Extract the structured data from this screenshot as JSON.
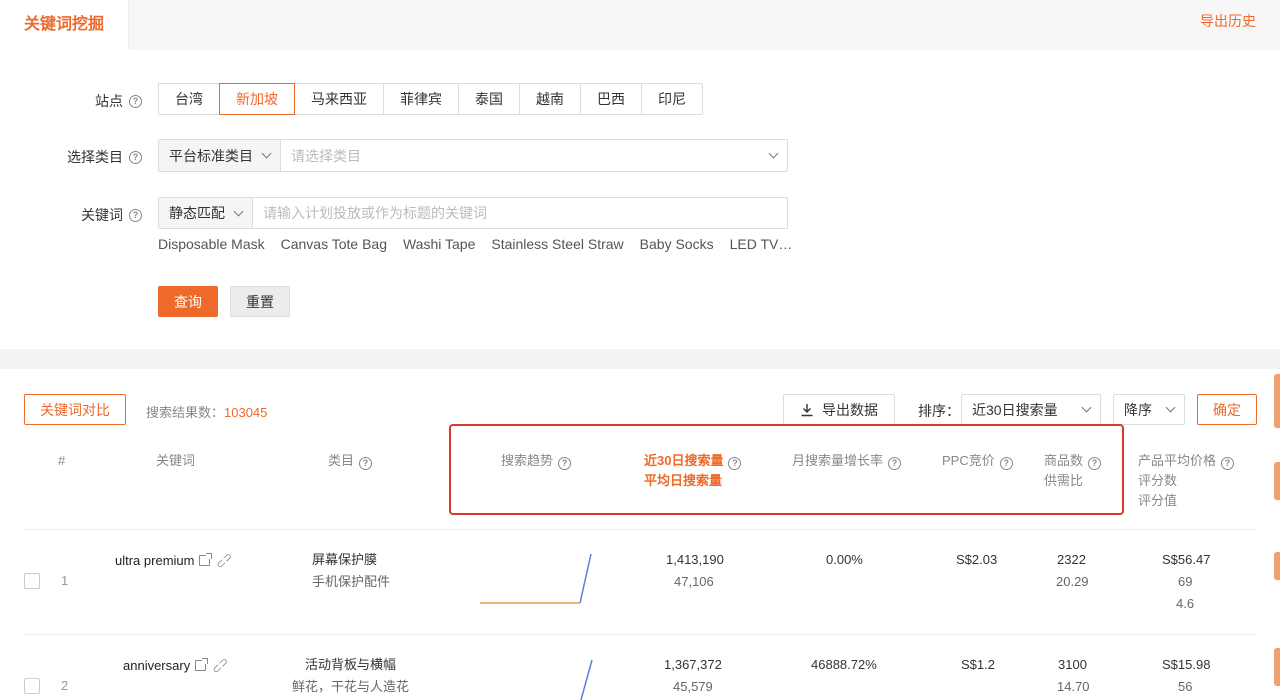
{
  "header": {
    "title": "关键词挖掘",
    "export_history": "导出历史"
  },
  "form": {
    "site_label": "站点",
    "sites": [
      "台湾",
      "新加坡",
      "马来西亚",
      "菲律宾",
      "泰国",
      "越南",
      "巴西",
      "印尼"
    ],
    "active_site": "新加坡",
    "category_label": "选择类目",
    "category_type": "平台标准类目",
    "category_placeholder": "请选择类目",
    "keyword_label": "关键词",
    "match_type": "静态匹配",
    "keyword_placeholder": "请输入计划投放或作为标题的关键词",
    "suggestions": [
      "Disposable Mask",
      "Canvas Tote Bag",
      "Washi Tape",
      "Stainless Steel Straw",
      "Baby Socks",
      "LED TV…"
    ],
    "query_button": "查询",
    "reset_button": "重置"
  },
  "results": {
    "compare_button": "关键词对比",
    "count_label": "搜索结果数：",
    "count_value": "103045",
    "export_button": "导出数据",
    "sort_label": "排序：",
    "sort_field": "近30日搜索量",
    "sort_order": "降序",
    "confirm_button": "确定",
    "columns": {
      "index": "#",
      "keyword": "关键词",
      "category": "类目",
      "trend": "搜索趋势",
      "search30": "近30日搜索量",
      "search_daily": "平均日搜索量",
      "growth": "月搜索量增长率",
      "ppc": "PPC竞价",
      "products": "商品数",
      "supply_ratio": "供需比",
      "avg_price": "产品平均价格",
      "rating_count": "评分数",
      "rating_value": "评分值"
    },
    "rows": [
      {
        "index": "1",
        "keyword": "ultra premium",
        "category": "屏幕保护膜",
        "subcategory": "手机保护配件",
        "search30": "1,413,190",
        "daily": "47,106",
        "growth": "0.00%",
        "ppc": "S$2.03",
        "products": "2322",
        "ratio": "20.29",
        "price": "S$56.47",
        "rating_count": "69",
        "rating_value": "4.6"
      },
      {
        "index": "2",
        "keyword": "anniversary",
        "category": "活动背板与横幅",
        "subcategory": "鲜花，干花与人造花",
        "search30": "1,367,372",
        "daily": "45,579",
        "growth": "46888.72%",
        "ppc": "S$1.2",
        "products": "3100",
        "ratio": "14.70",
        "price": "S$15.98",
        "rating_count": "56",
        "rating_value": ""
      }
    ]
  },
  "colors": {
    "accent": "#ee6a2a",
    "highlight_border": "#d93a2b",
    "sparkline_flat": "#e8a04c",
    "sparkline_rise": "#5b7fd9"
  }
}
